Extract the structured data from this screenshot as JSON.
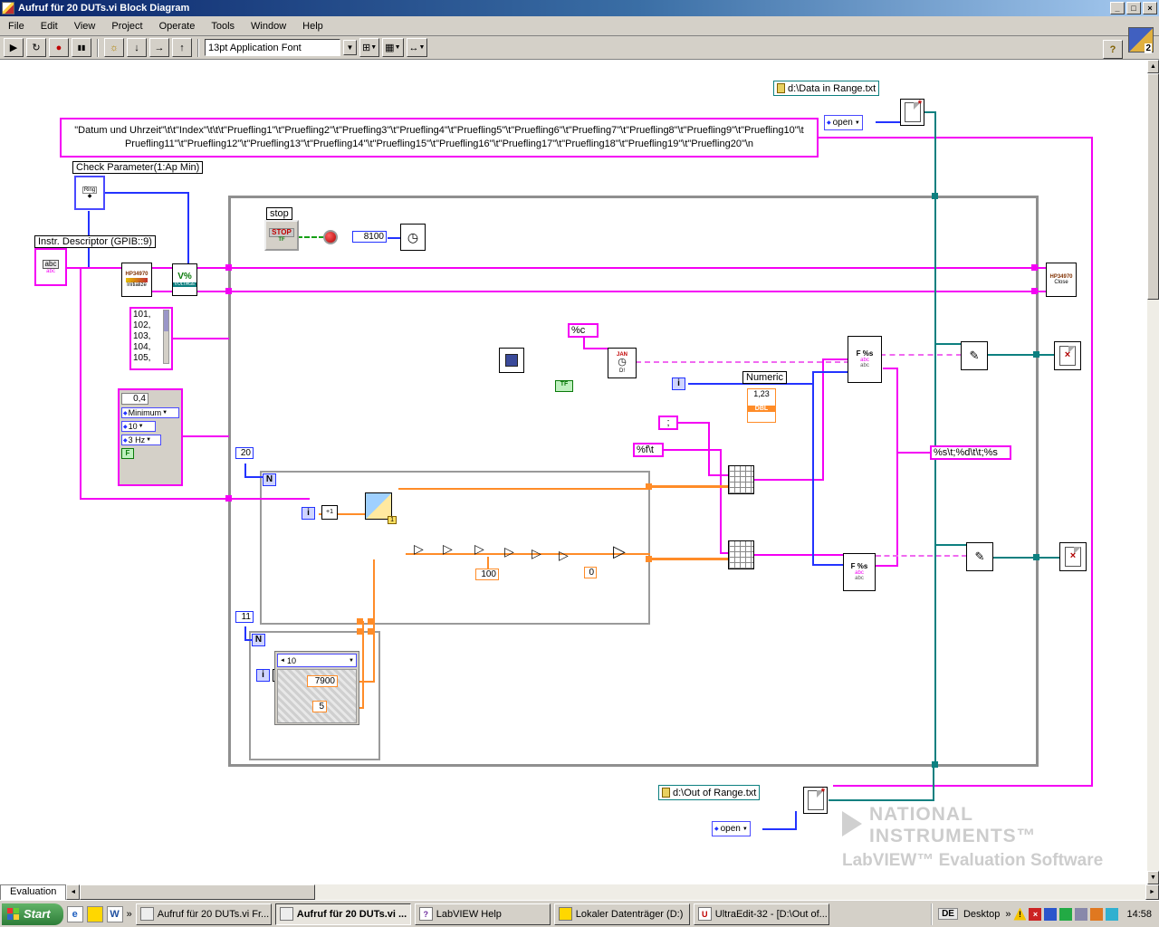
{
  "window": {
    "title": "Aufruf für 20 DUTs.vi Block Diagram"
  },
  "menubar": {
    "items": [
      "File",
      "Edit",
      "View",
      "Project",
      "Operate",
      "Tools",
      "Window",
      "Help"
    ]
  },
  "toolbar": {
    "font_selector": "13pt Application Font",
    "help": "?",
    "badge": "2"
  },
  "icons": {
    "minimize": "_",
    "maximize": "□",
    "close": "×",
    "run": "▶",
    "run_continuous": "↻",
    "abort": "●",
    "pause": "▮▮",
    "bulb": "☼",
    "step_into": "↓",
    "step_over": "→",
    "step_out": "↑",
    "dropdown": "▼",
    "diamond": "◆",
    "up": "▲",
    "down": "▼",
    "left": "◄",
    "right": "►",
    "chevron": "»",
    "clock": "◷",
    "pencil": "✎",
    "page_new": "*",
    "grid": "▦",
    "align": "⊞",
    "resize": "↔",
    "triangle_op": "▷",
    "equals": "≡",
    "excl": "!",
    "q": "?",
    "e": "e",
    "w": "W",
    "u": "U",
    "x": "×"
  },
  "diagram": {
    "header_string": {
      "line1": "\"Datum und Uhrzeit\"\\t\\t\"Index\"\\t\\t\\t\"Pruefling1\"\\t\"Pruefling2\"\\t\"Pruefling3\"\\t\"Pruefling4\"\\t\"Pruefling5\"\\t\"Pruefling6\"\\t\"Pruefling7\"\\t\"Pruefling8\"\\t\"Pruefling9\"\\t\"Pruefling10\"\\t",
      "line2": "Pruefling11\"\\t\"Pruefling12\"\\t\"Pruefling13\"\\t\"Pruefling14\"\\t\"Pruefling15\"\\t\"Pruefling16\"\\t\"Pruefling17\"\\t\"Pruefling18\"\\t\"Pruefling19\"\\t\"Pruefling20\"\\n"
    },
    "check_param_label": "Check Parameter(1:Ap Min)",
    "ring_label": "Ring",
    "instr_descriptor_label": "Instr. Descriptor (GPIB::9)",
    "string_control_label": "abc",
    "hp_init": {
      "l1": "HP34970",
      "l2": "Initialize"
    },
    "hp_config": {
      "l1": "V%",
      "l2": "VOLTAGE"
    },
    "hp_close": {
      "l1": "HP34970",
      "l2": "Close"
    },
    "stop": {
      "label": "stop",
      "button": "STOP",
      "tf": "TF"
    },
    "wait_ms": "8100",
    "channel_list": {
      "values": [
        "101,",
        "102,",
        "103,",
        "104,",
        "105,"
      ]
    },
    "scan_cluster": {
      "value": "0,4",
      "mode": "Minimum",
      "nplc": "10",
      "rate": "3 Hz",
      "bool": "F"
    },
    "loop1": {
      "count": "20",
      "n": "N",
      "i": "i",
      "plus_one": "+1",
      "const_100": "100",
      "const_0": "0",
      "frame": "1"
    },
    "loop2": {
      "count": "11",
      "n": "N",
      "i": "i",
      "index": "10",
      "v1": "7900",
      "v2": "5"
    },
    "fmt_c": "%c",
    "fmt_semicolon": ";",
    "fmt_f": "%f\\t",
    "fmt_s": "%s\\t;%d\\t\\t;%s",
    "numeric": {
      "label": "Numeric",
      "value": "1,23",
      "type": "DBL"
    },
    "time_node": {
      "l1": "JAN",
      "l2": "D!"
    },
    "format_node": {
      "l1": "F %s",
      "l2": "abc",
      "l3": "abc"
    },
    "file_top": {
      "path": "d:\\Data in Range.txt",
      "open": "open"
    },
    "file_bottom": {
      "path": "d:\\Out of Range.txt",
      "open": "open"
    },
    "i_terminal": "i",
    "tf_const": "TF"
  },
  "watermark": {
    "brand1": "NATIONAL",
    "brand2": "INSTRUMENTS™",
    "product": "LabVIEW™ Evaluation Software"
  },
  "statusbar": {
    "tab": "Evaluation"
  },
  "taskbar": {
    "start": "Start",
    "tasks": [
      {
        "label": "Aufruf für 20 DUTs.vi Fr..."
      },
      {
        "label": "Aufruf für 20 DUTs.vi ..."
      },
      {
        "label": "LabVIEW Help"
      },
      {
        "label": "Lokaler Datenträger (D:)"
      },
      {
        "label": "UltraEdit-32 - [D:\\Out of..."
      }
    ],
    "language": "DE",
    "desktop": "Desktop",
    "time": "14:58"
  }
}
